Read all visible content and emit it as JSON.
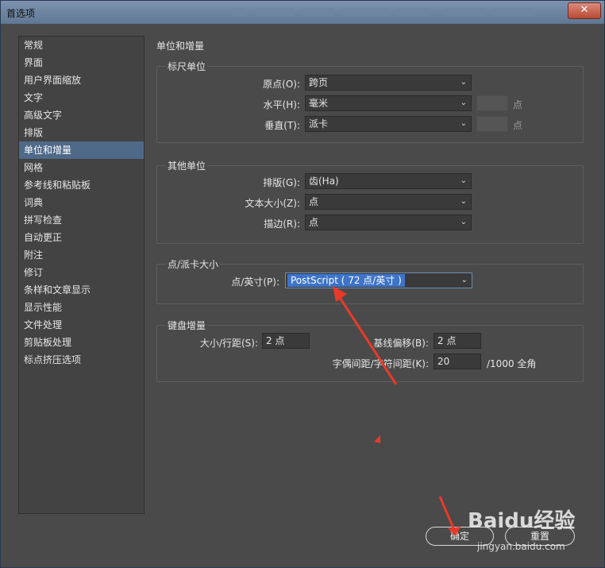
{
  "window": {
    "title": "首选项",
    "close_glyph": "✕"
  },
  "sidebar": {
    "items": [
      {
        "label": "常规"
      },
      {
        "label": "界面"
      },
      {
        "label": "用户界面缩放"
      },
      {
        "label": "文字"
      },
      {
        "label": "高级文字"
      },
      {
        "label": "排版"
      },
      {
        "label": "单位和增量"
      },
      {
        "label": "网格"
      },
      {
        "label": "参考线和粘贴板"
      },
      {
        "label": "词典"
      },
      {
        "label": "拼写检查"
      },
      {
        "label": "自动更正"
      },
      {
        "label": "附注"
      },
      {
        "label": "修订"
      },
      {
        "label": "条样和文章显示"
      },
      {
        "label": "显示性能"
      },
      {
        "label": "文件处理"
      },
      {
        "label": "剪贴板处理"
      },
      {
        "label": "标点挤压选项"
      }
    ],
    "active_index": 6
  },
  "section_title": "单位和增量",
  "ruler_units": {
    "legend": "标尺单位",
    "origin_label": "原点(O):",
    "origin_value": "跨页",
    "horizontal_label": "水平(H):",
    "horizontal_value": "毫米",
    "horizontal_unit": "点",
    "vertical_label": "垂直(T):",
    "vertical_value": "派卡",
    "vertical_unit": "点"
  },
  "other_units": {
    "legend": "其他单位",
    "composition_label": "排版(G):",
    "composition_value": "齿(Ha)",
    "text_size_label": "文本大小(Z):",
    "text_size_value": "点",
    "stroke_label": "描边(R):",
    "stroke_value": "点"
  },
  "point_pica": {
    "legend": "点/派卡大小",
    "points_per_inch_label": "点/英寸(P):",
    "points_per_inch_value": "PostScript ( 72 点/英寸 )"
  },
  "keyboard_increments": {
    "legend": "键盘增量",
    "size_leading_label": "大小/行距(S):",
    "size_leading_value": "2 点",
    "baseline_shift_label": "基线偏移(B):",
    "baseline_shift_value": "2 点",
    "kerning_label": "字偶间距/字符间距(K):",
    "kerning_value": "20",
    "kerning_unit": "/1000 全角"
  },
  "buttons": {
    "ok": "确定",
    "reset": "重置"
  },
  "watermark": {
    "main": "Baidu经验",
    "sub": "jingyan.baidu.com"
  },
  "colors": {
    "selection": "#3d74c9",
    "annotation_arrow": "#e83a2a",
    "active_item": "#4f6988"
  }
}
